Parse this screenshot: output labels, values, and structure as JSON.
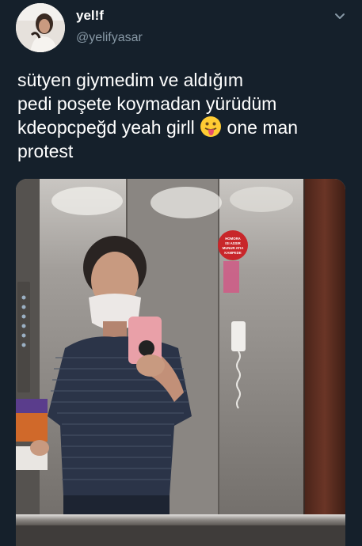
{
  "tweet": {
    "display_name": "yel!f",
    "handle": "@yelifyasar",
    "text_lines": [
      "sütyen giymedim ve aldığım",
      "pedi poşete koymadan yürüdüm",
      "kdeopcpeğd yeah girll",
      " one man",
      "protest"
    ],
    "emoji": "face-with-tongue-emoji"
  },
  "icons": {
    "caret": "chevron-down-icon",
    "avatar": "avatar"
  },
  "media": {
    "sign_text": [
      "HOMORA",
      "ISI ASSIR",
      "MUNUR ATIA",
      "KAMPEDE"
    ],
    "description_colors": {
      "background": "#15202b",
      "handle_gray": "#8899a6",
      "elevator_steel": "#8f8b86",
      "wood_panel": "#5c2f22",
      "shirt_navy": "#2b3448",
      "phone_pink": "#e9a0a8",
      "sign_red": "#c8262a"
    }
  }
}
